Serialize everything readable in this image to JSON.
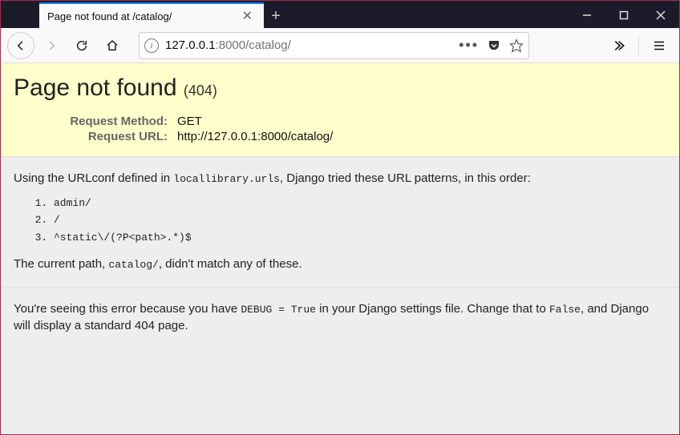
{
  "browser": {
    "tab_title": "Page not found at /catalog/",
    "url_display_host": "127.0.0.1",
    "url_display_port_path": ":8000/catalog/"
  },
  "error": {
    "heading": "Page not found",
    "status_code": "(404)",
    "request_method_label": "Request Method:",
    "request_method_value": "GET",
    "request_url_label": "Request URL:",
    "request_url_value": "http://127.0.0.1:8000/catalog/"
  },
  "info": {
    "intro_prefix": "Using the URLconf defined in ",
    "urlconf_module": "locallibrary.urls",
    "intro_suffix": ", Django tried these URL patterns, in this order:",
    "patterns": [
      "admin/",
      "/",
      "^static\\/(?P<path>.*)$"
    ],
    "nomatch_prefix": "The current path, ",
    "nomatch_path": "catalog/",
    "nomatch_suffix": ", didn't match any of these."
  },
  "explanation": {
    "prefix": "You're seeing this error because you have ",
    "debug_setting": "DEBUG = True",
    "middle": " in your Django settings file. Change that to ",
    "false_value": "False",
    "suffix": ", and Django will display a standard 404 page."
  }
}
